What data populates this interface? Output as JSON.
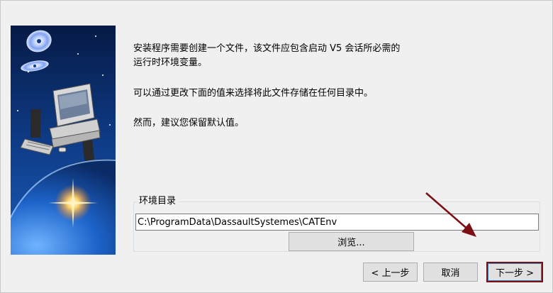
{
  "description": {
    "line1": "安装程序需要创建一个文件，该文件应包含启动 V5 会话所必需的",
    "line2": "运行时环境变量。",
    "paragraph2": "可以通过更改下面的值来选择将此文件存储在任何目录中。",
    "paragraph3": "然而，建议您保留默认值。"
  },
  "environment_group": {
    "legend": "环境目录",
    "path_value": "C:\\ProgramData\\DassaultSystemes\\CATEnv",
    "browse_label": "浏览..."
  },
  "buttons": {
    "back_label": "< 上一步",
    "cancel_label": "取消",
    "next_label": "下一步 >"
  },
  "colors": {
    "dialog_bg": "#f0f0f0",
    "highlight_border": "#7b0f14",
    "arrow": "#7b0f14"
  },
  "icons": {
    "side_image": "computer-in-space-illustration",
    "annotation": "arrow-pointing-to-next-button"
  }
}
